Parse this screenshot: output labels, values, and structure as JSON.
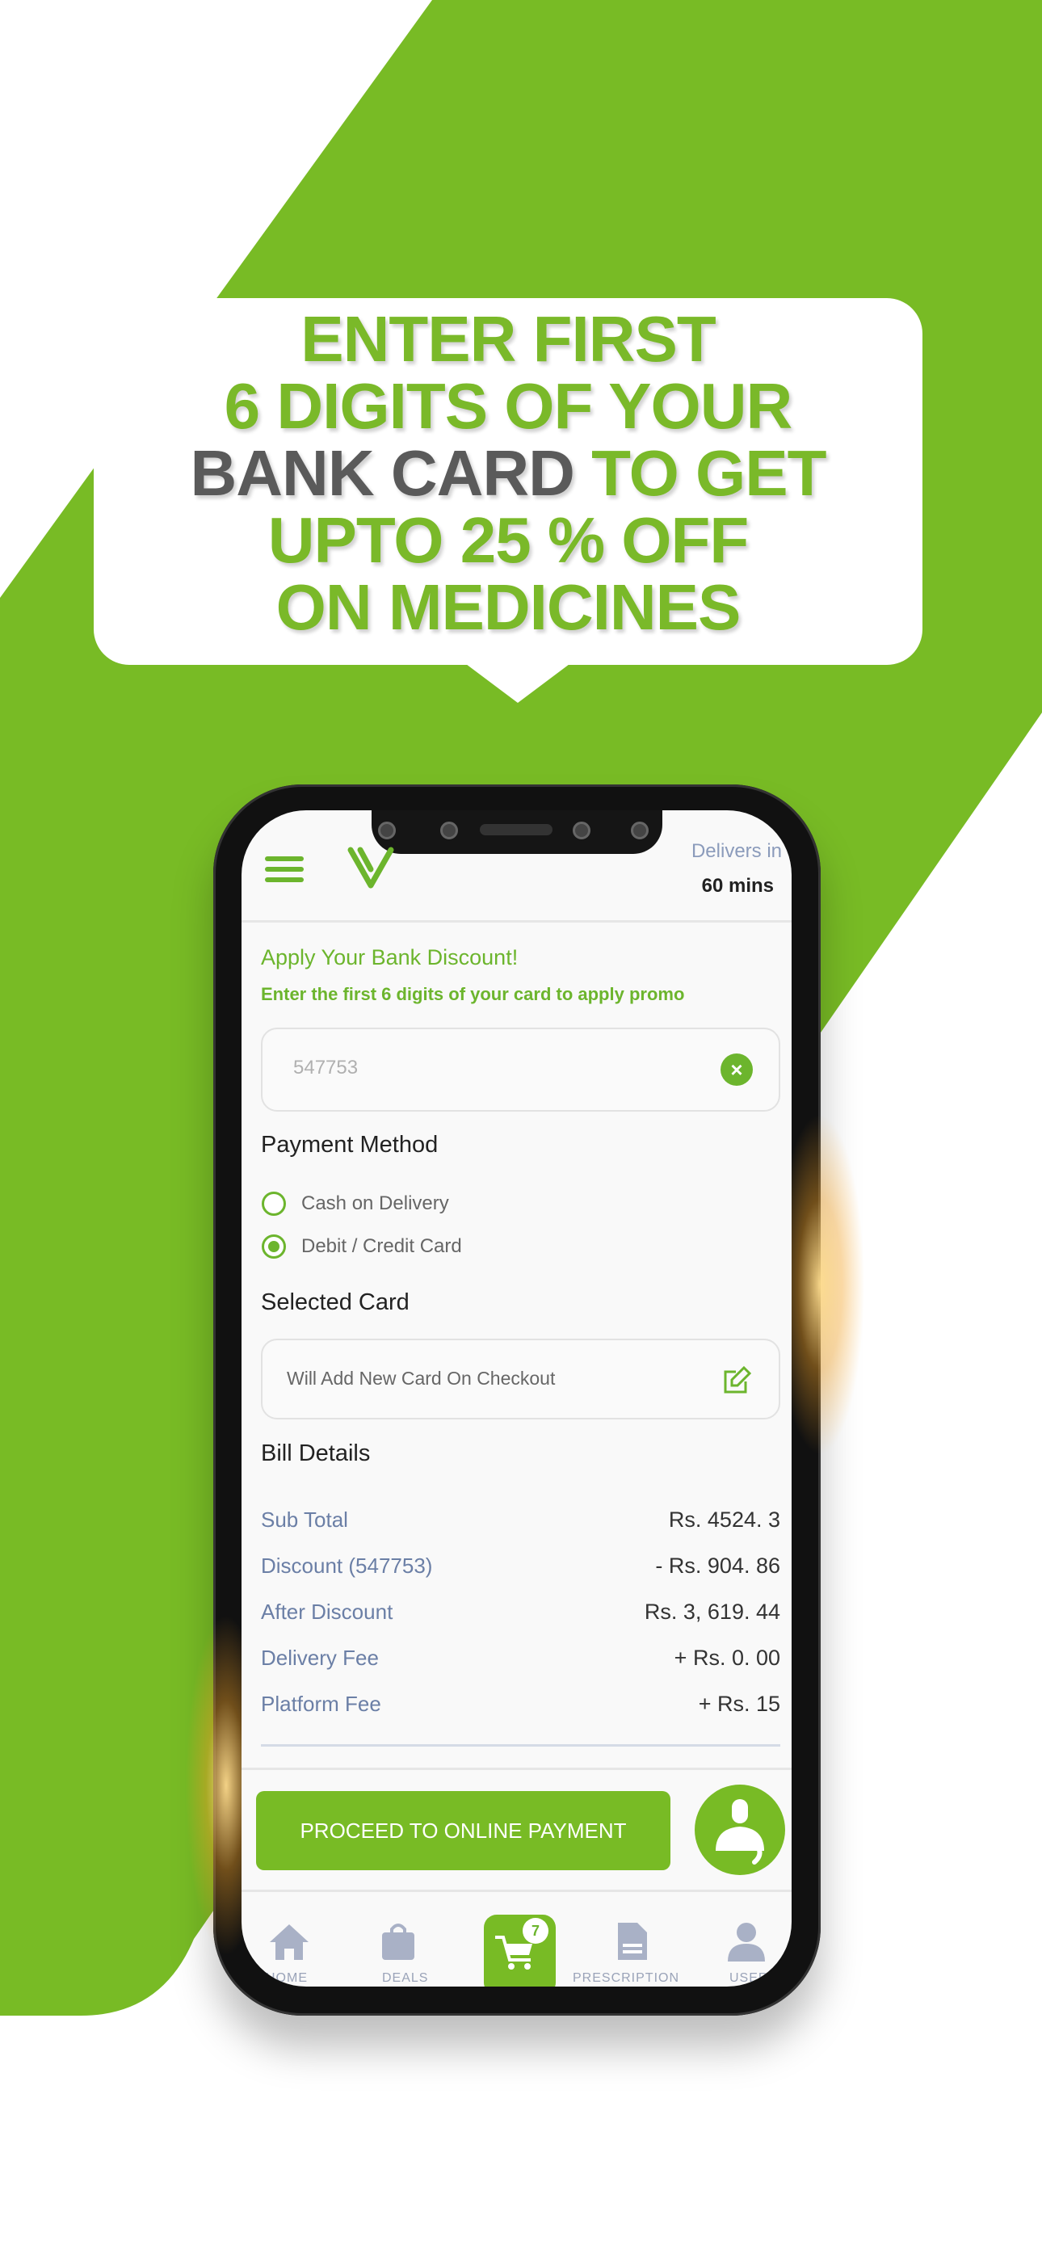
{
  "promo": {
    "line1": "ENTER FIRST",
    "line2": "6 DIGITS OF YOUR",
    "line3_dark": "BANK CARD",
    "line3_green": " TO GET",
    "line4": "UPTO 25 % OFF",
    "line5": "ON MEDICINES"
  },
  "header": {
    "delivers_label": "Delivers in",
    "delivers_time": "60 mins"
  },
  "discount": {
    "title": "Apply Your Bank Discount!",
    "subtitle": "Enter the first 6 digits of your card to apply promo",
    "input_value": "547753"
  },
  "payment": {
    "title": "Payment Method",
    "options": [
      {
        "label": "Cash on Delivery",
        "selected": false
      },
      {
        "label": "Debit / Credit Card",
        "selected": true
      }
    ]
  },
  "card": {
    "title": "Selected Card",
    "value": "Will Add New Card On Checkout"
  },
  "bill": {
    "title": "Bill Details",
    "rows": [
      {
        "label": "Sub Total",
        "value": "Rs.  4524. 3"
      },
      {
        "label": "Discount (547753)",
        "value": "- Rs.  904. 86"
      },
      {
        "label": "After Discount",
        "value": "Rs.  3, 619. 44"
      },
      {
        "label": "Delivery Fee",
        "value": "+ Rs.  0. 00"
      },
      {
        "label": "Platform Fee",
        "value": "+ Rs.  15"
      }
    ]
  },
  "cta": {
    "label": "PROCEED TO ONLINE PAYMENT"
  },
  "nav": {
    "items": [
      {
        "label": "HOME"
      },
      {
        "label": "DEALS"
      },
      {
        "label": "CART",
        "badge": "7"
      },
      {
        "label": "PRESCRIPTION"
      },
      {
        "label": "USER"
      }
    ]
  },
  "colors": {
    "brand": "#6cb52d",
    "background_green": "#78bb25"
  }
}
